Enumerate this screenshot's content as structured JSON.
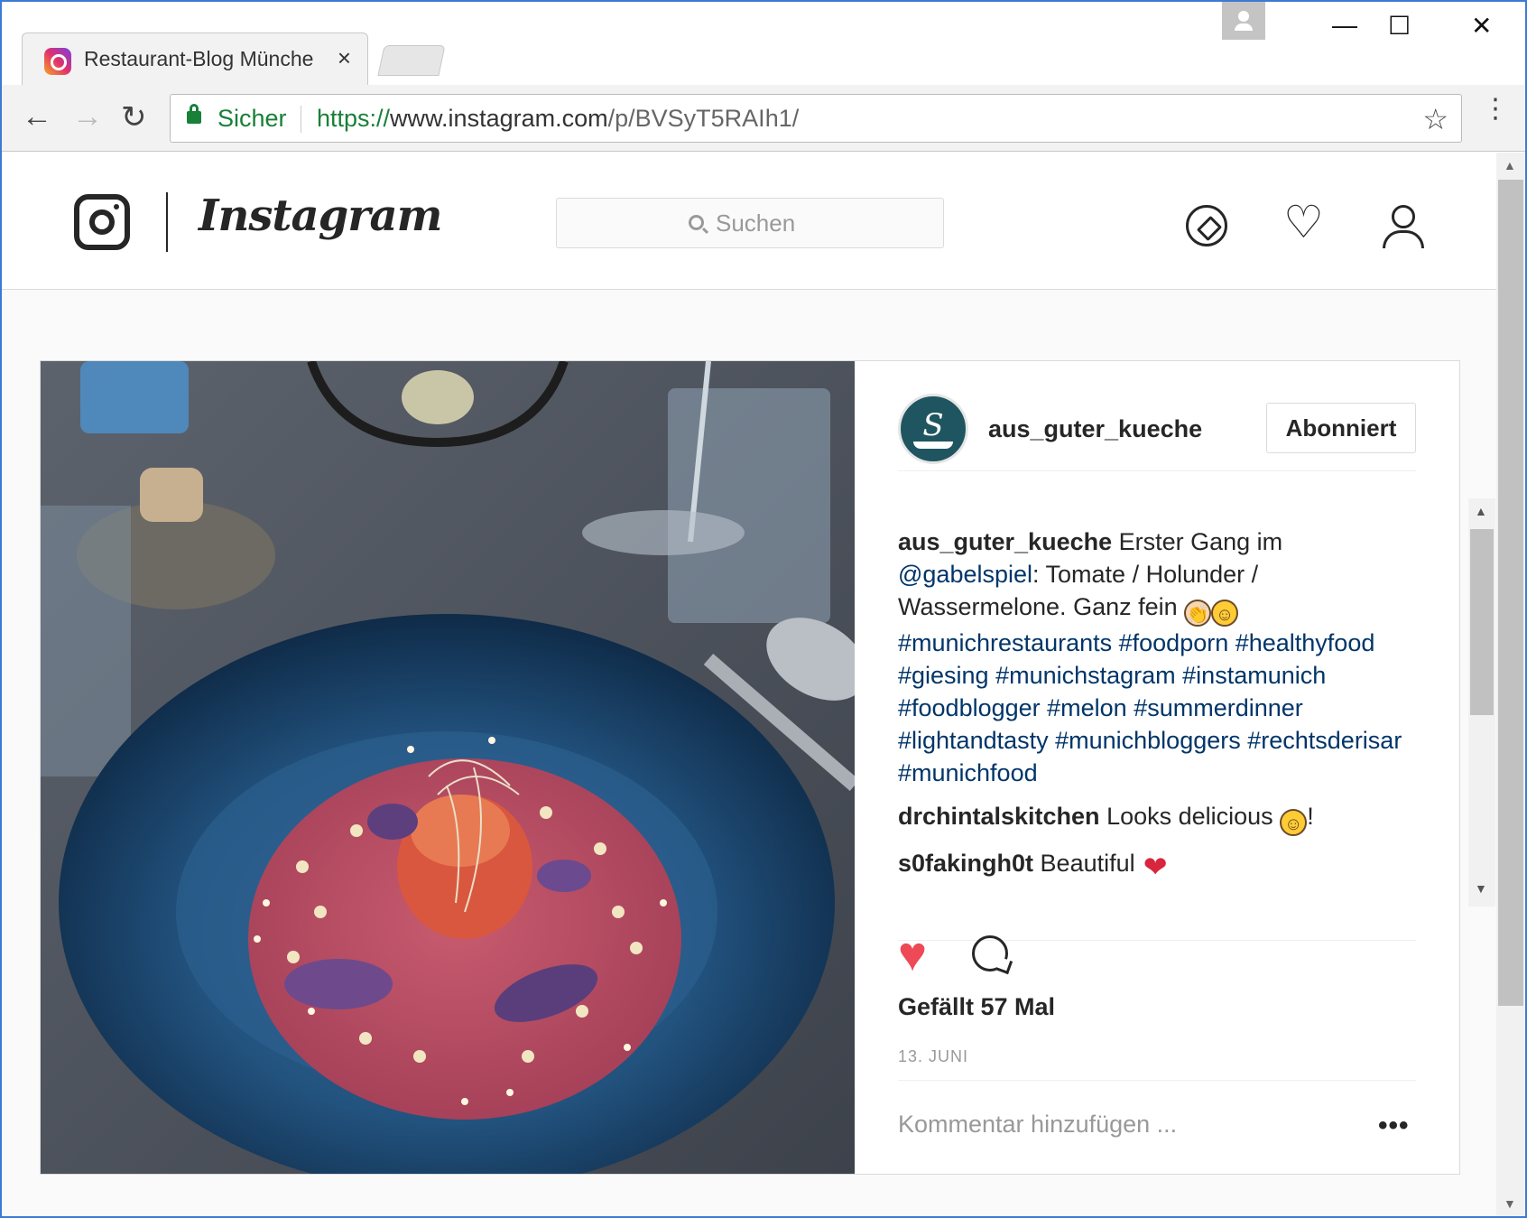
{
  "browser": {
    "tab_title": "Restaurant-Blog Münche",
    "tab_close": "×",
    "win_minimize": "—",
    "win_maximize": "☐",
    "win_close": "✕",
    "back": "←",
    "forward": "→",
    "reload": "↻",
    "secure_label": "Sicher",
    "url_scheme": "https://",
    "url_host": "www.instagram.com",
    "url_path": "/p/BVSyT5RAIh1/",
    "bookmark_star": "☆",
    "menu": "⋮"
  },
  "instagram": {
    "wordmark": "Instagram",
    "search_placeholder": "Suchen",
    "heart_outline": "♡"
  },
  "post": {
    "username": "aus_guter_kueche",
    "avatar_letter": "S",
    "follow_label": "Abonniert",
    "caption": {
      "author": "aus_guter_kueche",
      "text_before": " Erster Gang im ",
      "mention": "@gabelspiel",
      "text_after": ": Tomate / Holunder / Wassermelone. Ganz fein ",
      "hashtags": "#munichrestaurants #foodporn #healthyfood #giesing #munichstagram #instamunich #foodblogger #melon #summerdinner #lightandtasty #munichbloggers #rechtsderisar #munichfood"
    },
    "comments": [
      {
        "author": "drchintalskitchen",
        "text": " Looks delicious ",
        "suffix": "!"
      },
      {
        "author": "s0fakingh0t",
        "text": " Beautiful "
      }
    ],
    "like_icon": "♥",
    "likes_text": "Gefällt 57 Mal",
    "date": "13. JUNI",
    "add_comment_placeholder": "Kommentar hinzufügen ...",
    "more": "•••"
  },
  "colors": {
    "accent_green": "#188038",
    "link_blue": "#003569",
    "like_red": "#ed4956"
  }
}
